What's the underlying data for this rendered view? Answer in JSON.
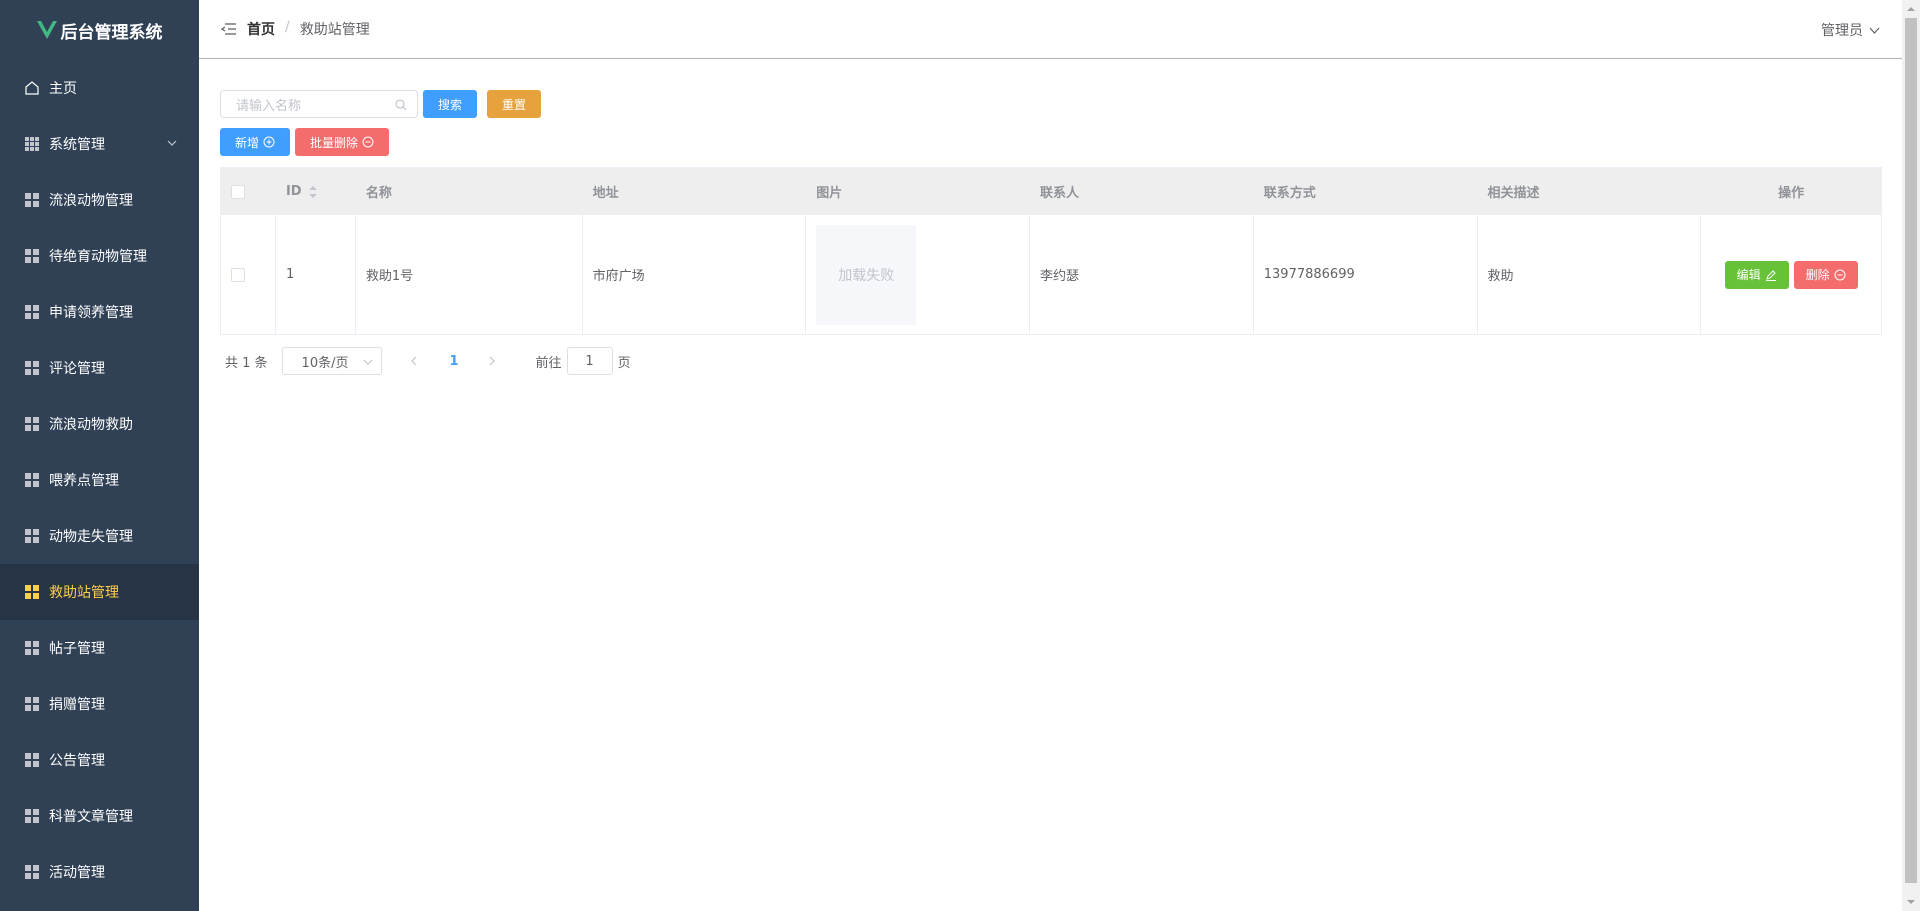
{
  "sidebar": {
    "logo_text": "后台管理系统",
    "items": [
      {
        "label": "主页"
      },
      {
        "label": "系统管理"
      },
      {
        "label": "流浪动物管理"
      },
      {
        "label": "待绝育动物管理"
      },
      {
        "label": "申请领养管理"
      },
      {
        "label": "评论管理"
      },
      {
        "label": "流浪动物救助"
      },
      {
        "label": "喂养点管理"
      },
      {
        "label": "动物走失管理"
      },
      {
        "label": "救助站管理"
      },
      {
        "label": "帖子管理"
      },
      {
        "label": "捐赠管理"
      },
      {
        "label": "公告管理"
      },
      {
        "label": "科普文章管理"
      },
      {
        "label": "活动管理"
      }
    ]
  },
  "header": {
    "breadcrumb_home": "首页",
    "breadcrumb_sep": "/",
    "breadcrumb_current": "救助站管理",
    "user": "管理员"
  },
  "toolbar": {
    "search_placeholder": "请输入名称",
    "search_label": "搜索",
    "reset_label": "重置",
    "add_label": "新增",
    "batch_delete_label": "批量删除"
  },
  "table": {
    "columns": [
      "ID",
      "名称",
      "地址",
      "图片",
      "联系人",
      "联系方式",
      "相关描述",
      "操作"
    ],
    "rows": [
      {
        "id": "1",
        "name": "救助1号",
        "address": "市府广场",
        "image": "加载失败",
        "contact": "李约瑟",
        "phone": "13977886699",
        "desc": "救助",
        "edit": "编辑",
        "delete": "删除"
      }
    ]
  },
  "pagination": {
    "total": "共 1 条",
    "page_size": "10条/页",
    "current_page": "1",
    "goto_prefix": "前往",
    "goto_value": "1",
    "goto_suffix": "页"
  },
  "colors": {
    "sidebar_bg": "#304156",
    "active_text": "#ffd04b",
    "primary": "#409eff",
    "warning": "#e6a23c",
    "danger": "#f56c6c",
    "success": "#67c23a",
    "logo_green": "#42b983"
  }
}
